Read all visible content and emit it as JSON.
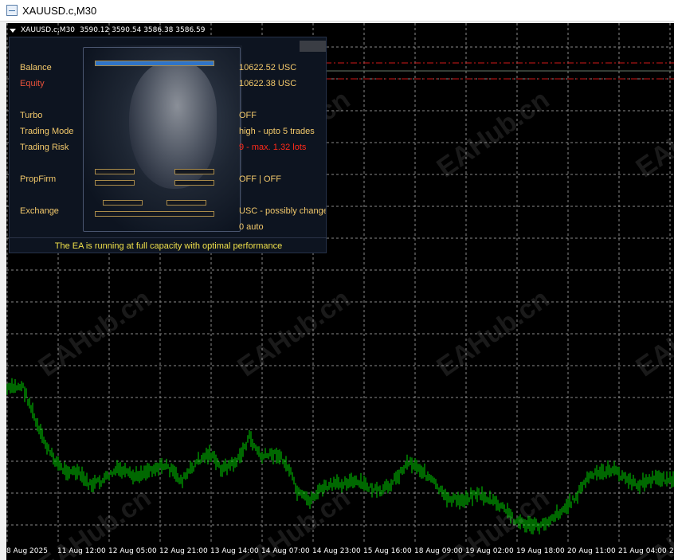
{
  "window": {
    "title": "XAUUSD.c,M30"
  },
  "chart": {
    "header": {
      "symbol": "XAUUSD.c,M30",
      "ohlc": "3590.12 3590.54 3586.38 3586.59"
    },
    "watermark": "EAHub.cn",
    "x_ticks": [
      "8 Aug 2025",
      "11 Aug 12:00",
      "12 Aug 05:00",
      "12 Aug 21:00",
      "13 Aug 14:00",
      "14 Aug 07:00",
      "14 Aug 23:00",
      "15 Aug 16:00",
      "18 Aug 09:00",
      "19 Aug 02:00",
      "19 Aug 18:00",
      "20 Aug 11:00",
      "21 Aug 04:00",
      "2"
    ],
    "colors": {
      "background": "#000000",
      "grid": "#8a8a8a",
      "bars": "#00d000",
      "level_line": "#d01818"
    }
  },
  "panel": {
    "balance": {
      "label": "Balance",
      "value": "10622.52 USC",
      "bar_fill": 1.0
    },
    "equity": {
      "label": "Equity",
      "value": "10622.38 USC"
    },
    "turbo": {
      "label": "Turbo",
      "value": "OFF"
    },
    "trading_mode": {
      "label": "Trading Mode",
      "value": "high - upto 5 trades"
    },
    "trading_risk": {
      "label": "Trading Risk",
      "value": "9 - max. 1.32 lots"
    },
    "propfirm": {
      "label": "PropFirm",
      "value": "OFF | OFF"
    },
    "exchange": {
      "label": "Exchange",
      "value": "USC - possibly change",
      "extra": "0 auto"
    },
    "status": "The EA is running at full capacity with optimal performance"
  }
}
